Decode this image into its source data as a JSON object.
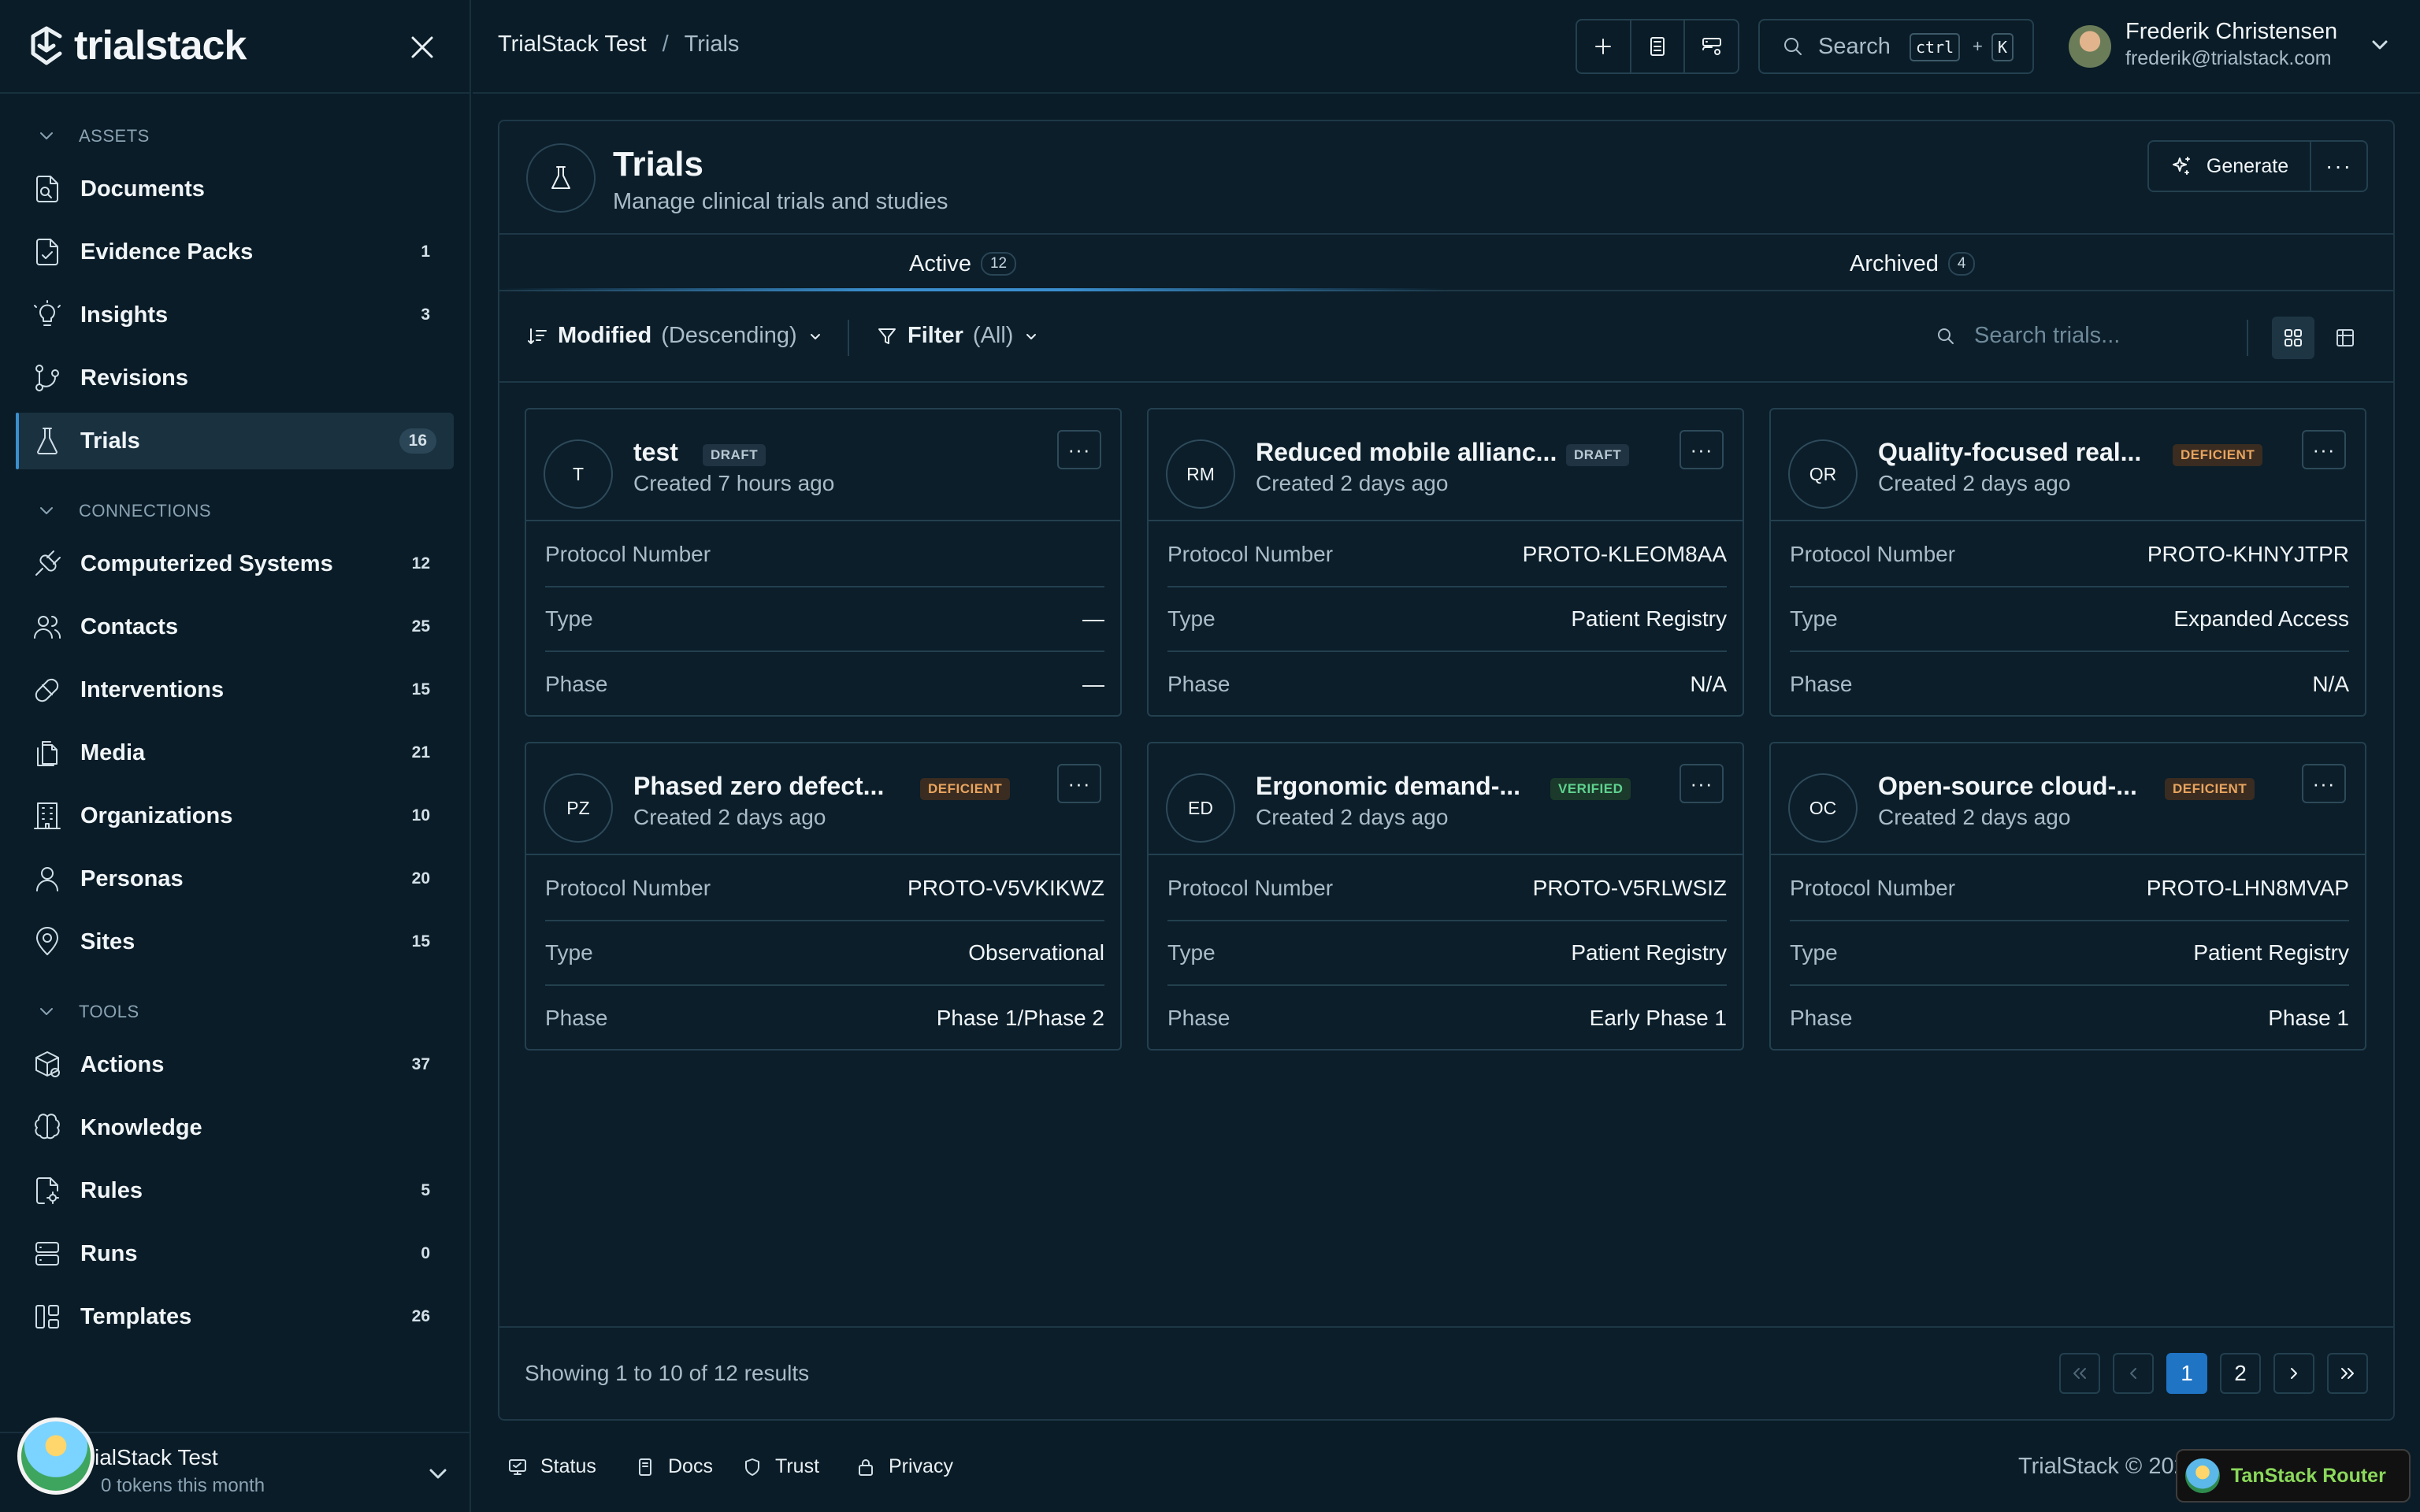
{
  "app": {
    "logo_text": "trialstack",
    "colors": {
      "accent": "#3b8fcf",
      "background": "#0a1c27",
      "deficient": "#e9a55f",
      "verified": "#5fd38f"
    }
  },
  "sidebar": {
    "sections": [
      {
        "label": "ASSETS"
      },
      {
        "label": "CONNECTIONS"
      },
      {
        "label": "TOOLS"
      }
    ],
    "items": [
      {
        "label": "Documents",
        "count": ""
      },
      {
        "label": "Evidence Packs",
        "count": "1"
      },
      {
        "label": "Insights",
        "count": "3"
      },
      {
        "label": "Revisions",
        "count": ""
      },
      {
        "label": "Trials",
        "count": "16"
      },
      {
        "label": "Computerized Systems",
        "count": "12"
      },
      {
        "label": "Contacts",
        "count": "25"
      },
      {
        "label": "Interventions",
        "count": "15"
      },
      {
        "label": "Media",
        "count": "21"
      },
      {
        "label": "Organizations",
        "count": "10"
      },
      {
        "label": "Personas",
        "count": "20"
      },
      {
        "label": "Sites",
        "count": "15"
      },
      {
        "label": "Actions",
        "count": "37"
      },
      {
        "label": "Knowledge",
        "count": ""
      },
      {
        "label": "Rules",
        "count": "5"
      },
      {
        "label": "Runs",
        "count": "0"
      },
      {
        "label": "Templates",
        "count": "26"
      }
    ],
    "workspace": {
      "name": "ialStack Test",
      "tokens": "0 tokens this month"
    }
  },
  "header": {
    "breadcrumb": [
      "TrialStack Test",
      "/",
      "Trials"
    ],
    "search_label": "Search",
    "kbd_ctrl": "ctrl",
    "kbd_plus": "+",
    "kbd_k": "K",
    "user": {
      "name": "Frederik Christensen",
      "email": "frederik@trialstack.com"
    }
  },
  "page": {
    "title": "Trials",
    "subtitle": "Manage clinical trials and studies",
    "generate_label": "Generate",
    "more_label": "···",
    "tabs": [
      {
        "label": "Active",
        "count": "12"
      },
      {
        "label": "Archived",
        "count": "4"
      }
    ],
    "sort": {
      "field": "Modified",
      "order": "(Descending)"
    },
    "filter": {
      "label": "Filter",
      "value": "(All)"
    },
    "search_placeholder": "Search trials..."
  },
  "cards": [
    {
      "initials": "T",
      "title": "test",
      "status": "DRAFT",
      "created": "Created 7 hours ago",
      "rows": [
        {
          "k": "Protocol Number",
          "v": ""
        },
        {
          "k": "Type",
          "v": "—"
        },
        {
          "k": "Phase",
          "v": "—"
        }
      ]
    },
    {
      "initials": "RM",
      "title": "Reduced mobile allianc...",
      "status": "DRAFT",
      "created": "Created 2 days ago",
      "rows": [
        {
          "k": "Protocol Number",
          "v": "PROTO-KLEOM8AA"
        },
        {
          "k": "Type",
          "v": "Patient Registry"
        },
        {
          "k": "Phase",
          "v": "N/A"
        }
      ]
    },
    {
      "initials": "QR",
      "title": "Quality-focused real...",
      "status": "DEFICIENT",
      "created": "Created 2 days ago",
      "rows": [
        {
          "k": "Protocol Number",
          "v": "PROTO-KHNYJTPR"
        },
        {
          "k": "Type",
          "v": "Expanded Access"
        },
        {
          "k": "Phase",
          "v": "N/A"
        }
      ]
    },
    {
      "initials": "PZ",
      "title": "Phased zero defect...",
      "status": "DEFICIENT",
      "created": "Created 2 days ago",
      "rows": [
        {
          "k": "Protocol Number",
          "v": "PROTO-V5VKIKWZ"
        },
        {
          "k": "Type",
          "v": "Observational"
        },
        {
          "k": "Phase",
          "v": "Phase 1/Phase 2"
        }
      ]
    },
    {
      "initials": "ED",
      "title": "Ergonomic demand-...",
      "status": "VERIFIED",
      "created": "Created 2 days ago",
      "rows": [
        {
          "k": "Protocol Number",
          "v": "PROTO-V5RLWSIZ"
        },
        {
          "k": "Type",
          "v": "Patient Registry"
        },
        {
          "k": "Phase",
          "v": "Early Phase 1"
        }
      ]
    },
    {
      "initials": "OC",
      "title": "Open-source cloud-...",
      "status": "DEFICIENT",
      "created": "Created 2 days ago",
      "rows": [
        {
          "k": "Protocol Number",
          "v": "PROTO-LHN8MVAP"
        },
        {
          "k": "Type",
          "v": "Patient Registry"
        },
        {
          "k": "Phase",
          "v": "Phase 1"
        }
      ]
    }
  ],
  "pagination": {
    "summary": "Showing 1 to 10 of 12 results",
    "pages": [
      "1",
      "2"
    ],
    "current": "1"
  },
  "footer": {
    "links": [
      "Status",
      "Docs",
      "Trust",
      "Privacy"
    ],
    "copyright": "TrialStack © 202",
    "devtools": "TanStack Router"
  }
}
